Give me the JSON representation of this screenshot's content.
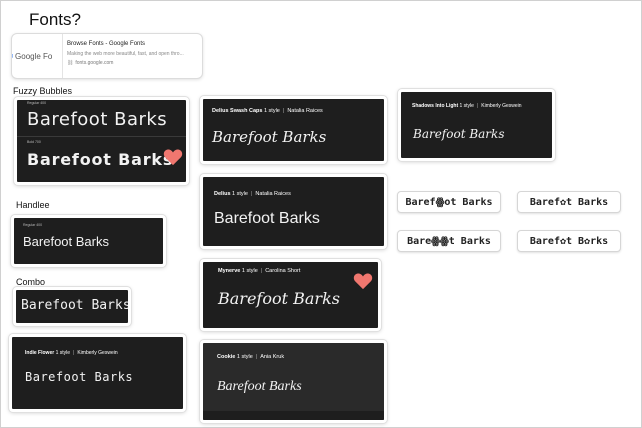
{
  "page": {
    "title": "Fonts?"
  },
  "link_card": {
    "logo_text": "Google Fo",
    "title": "Browse Fonts - Google Fonts",
    "description": "Making the web more beautiful, fast, and open thro...",
    "url": "fonts.google.com"
  },
  "labels": {
    "fuzzy": "Fuzzy Bubbles",
    "handlee": "Handlee",
    "combo": "Combo"
  },
  "sample_text": "Barefoot Barks",
  "cards": {
    "fuzzy": {
      "regular_tag": "Regular 400",
      "bold_tag": "Bold 700"
    },
    "swash": {
      "name": "Delius Swash Caps",
      "styles": "1 style",
      "author": "Natalia Raices"
    },
    "shadows": {
      "name": "Shadows Into Light",
      "styles": "1 style",
      "author": "Kimberly Geswein"
    },
    "delius": {
      "name": "Delius",
      "styles": "1 style",
      "author": "Natalia Raices"
    },
    "handlee": {
      "regular_tag": "Regular 400"
    },
    "mynerve": {
      "name": "Mynerve",
      "styles": "1 style",
      "author": "Carolina Short"
    },
    "indie": {
      "name": "Indie Flower",
      "styles": "1 style",
      "author": "Kimberly Geswein"
    },
    "cookie": {
      "name": "Cookie",
      "styles": "1 style",
      "author": "Ania Kruk"
    }
  },
  "paw_tiles": [
    {
      "text": "Barefꙮot Barks"
    },
    {
      "text": "Baref✿t Barks"
    },
    {
      "text": "Bareꙮꙮt Barks"
    },
    {
      "text": "Baref✿t B✿rks"
    }
  ],
  "colors": {
    "heart": "#f0776f",
    "card_bg": "#1e1e1e"
  }
}
